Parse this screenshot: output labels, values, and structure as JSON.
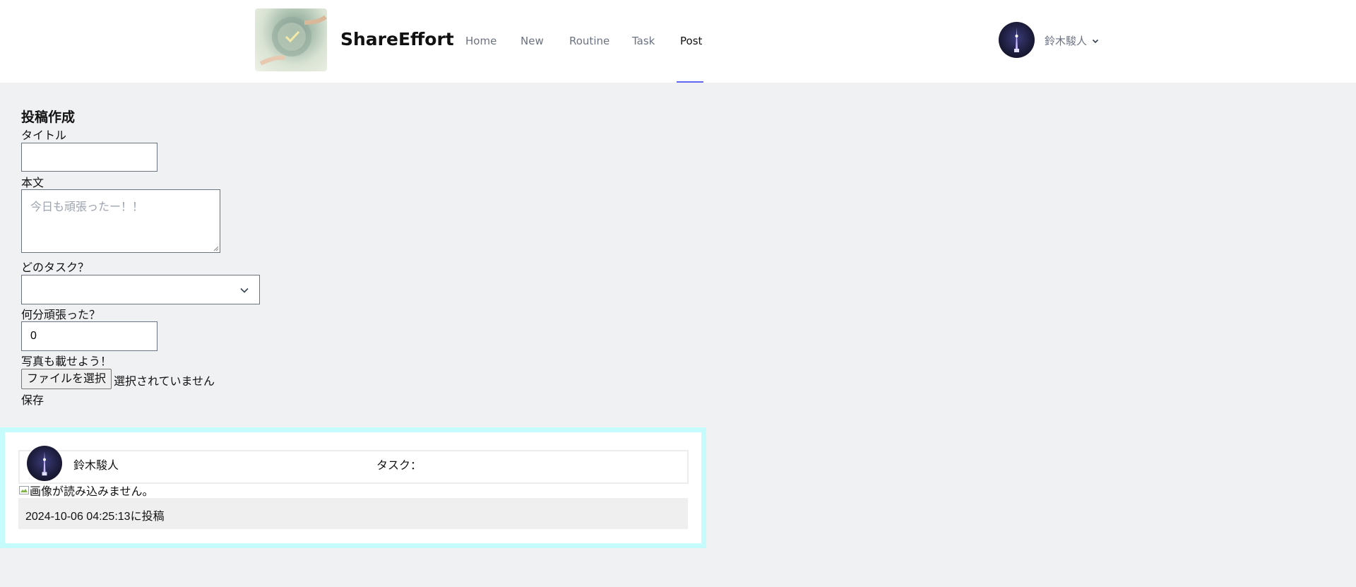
{
  "header": {
    "brand": "ShareEffort",
    "nav": [
      {
        "label": "Home",
        "active": false
      },
      {
        "label": "New",
        "active": false
      },
      {
        "label": "Routine",
        "active": false
      },
      {
        "label": "Task",
        "active": false
      },
      {
        "label": "Post",
        "active": true
      }
    ],
    "user_name": "鈴木駿人",
    "accent_color": "#6366f1"
  },
  "form": {
    "title": "投稿作成",
    "title_label": "タイトル",
    "title_value": "",
    "body_label": "本文",
    "body_placeholder": "今日も頑張ったー！！",
    "task_label": "どのタスク？",
    "task_selected": "",
    "minutes_label": "何分頑張った？",
    "minutes_value": "0",
    "photo_label": "写真も載せよう！",
    "file_button": "ファイルを選択",
    "file_status": "選択されていません",
    "save_label": "保存"
  },
  "post": {
    "user_name": "鈴木駿人",
    "task_label": "タスク：",
    "image_alt": "画像が読み込みません。",
    "posted_at": "2024-10-06 04:25:13に投稿",
    "card_border_color": "#c5fbfb"
  }
}
